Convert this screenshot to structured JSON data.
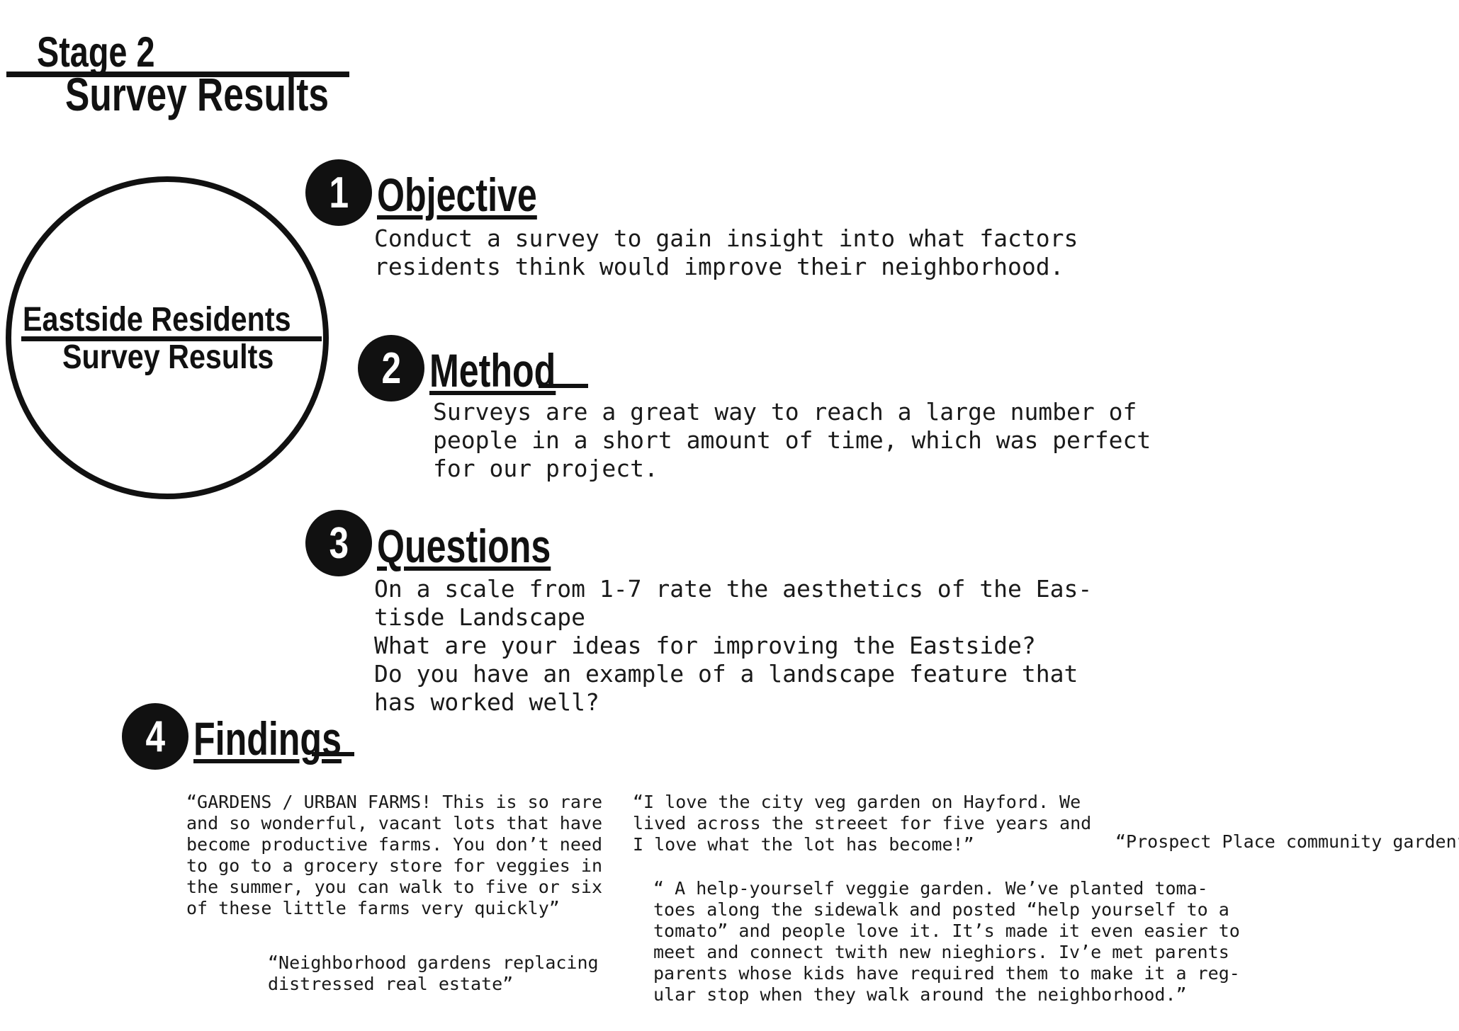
{
  "header": {
    "stage": "Stage 2",
    "subtitle": "Survey Results"
  },
  "circle": {
    "line1": "Eastside Residents",
    "line2": "Survey Results"
  },
  "sections": [
    {
      "number": "1",
      "heading": "Objective",
      "lines": [
        "Conduct a survey to gain insight into what factors",
        "residents think would improve their neighborhood."
      ]
    },
    {
      "number": "2",
      "heading": "Method",
      "lines": [
        "Surveys are a great way to reach a large number of",
        "people in a short amount of time, which was perfect",
        "for our project."
      ]
    },
    {
      "number": "3",
      "heading": "Questions",
      "lines": [
        "On a scale from 1-7 rate the aesthetics of the Eas-",
        "tisde Landscape",
        "What are your ideas for improving the Eastside?",
        "Do you have an example of a landscape feature that",
        "has worked well?"
      ]
    },
    {
      "number": "4",
      "heading": "Findings",
      "lines": []
    }
  ],
  "quotes": [
    {
      "lines": [
        "“GARDENS / URBAN FARMS! This is so rare",
        "and so wonderful, vacant lots that have",
        "become productive farms. You don’t need",
        "to go to a grocery store for veggies in",
        "the summer, you can walk to five or six",
        "of these little farms very quickly”"
      ]
    },
    {
      "lines": [
        "“Neighborhood gardens replacing",
        "distressed real estate”"
      ]
    },
    {
      "lines": [
        "“I love the city veg garden on Hayford. We",
        "lived across the streeet for five years and",
        "I love what the lot has become!”"
      ]
    },
    {
      "lines": [
        "“Prospect Place community garden”"
      ]
    },
    {
      "lines": [
        "“ A help-yourself veggie garden. We’ve planted toma-",
        "toes along the sidewalk and posted “help yourself to a",
        "tomato” and people love it. It’s made it even easier to",
        "meet and connect twith new nieghiors. Iv’e met parents",
        "parents whose kids have required them to make it a reg-",
        "ular stop when they walk around the neighborhood.”"
      ]
    }
  ]
}
